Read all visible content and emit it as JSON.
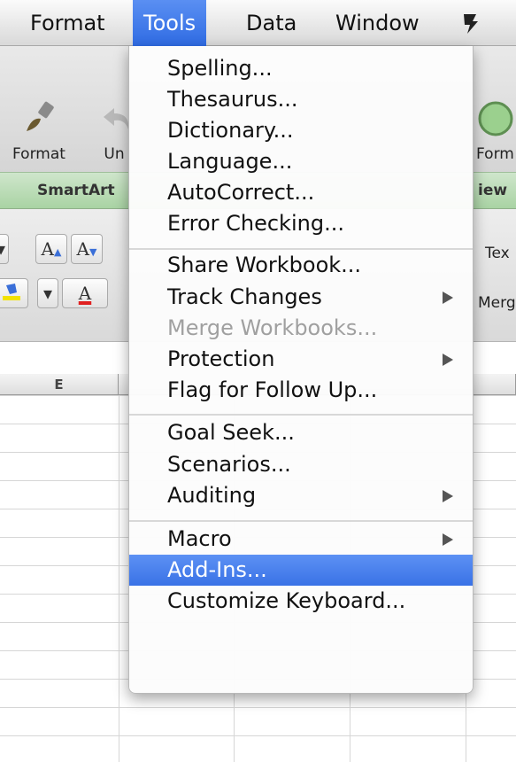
{
  "menubar": {
    "items": [
      "Format",
      "Tools",
      "Data",
      "Window"
    ],
    "active": "Tools",
    "script_icon": "script-menu-icon"
  },
  "ribbon": {
    "format_label": "Format",
    "undo_label": "Un",
    "format_right_label": "Form",
    "smartart_tab": "SmartArt",
    "review_tab": "iew",
    "wrap_text_label": "Tex",
    "merge_label": "Merge",
    "font_size_up": "A",
    "font_size_down": "A",
    "font_color": "A"
  },
  "sheet": {
    "column_e": "E"
  },
  "tools_menu": {
    "groups": [
      [
        "Spelling...",
        "Thesaurus...",
        "Dictionary...",
        "Language...",
        "AutoCorrect...",
        "Error Checking..."
      ],
      [
        "Share Workbook...",
        "Track Changes",
        "Merge Workbooks...",
        "Protection",
        "Flag for Follow Up..."
      ],
      [
        "Goal Seek...",
        "Scenarios...",
        "Auditing"
      ],
      [
        "Macro",
        "Add-Ins...",
        "Customize Keyboard..."
      ]
    ],
    "submenu_items": [
      "Track Changes",
      "Protection",
      "Auditing",
      "Macro"
    ],
    "disabled_items": [
      "Merge Workbooks..."
    ],
    "selected_item": "Add-Ins..."
  },
  "colors": {
    "selection": "#3a72e6",
    "tab_strip": "#a9d3a4",
    "font_color_bar": "#e02020",
    "highlight_bar": "#f2e200"
  }
}
